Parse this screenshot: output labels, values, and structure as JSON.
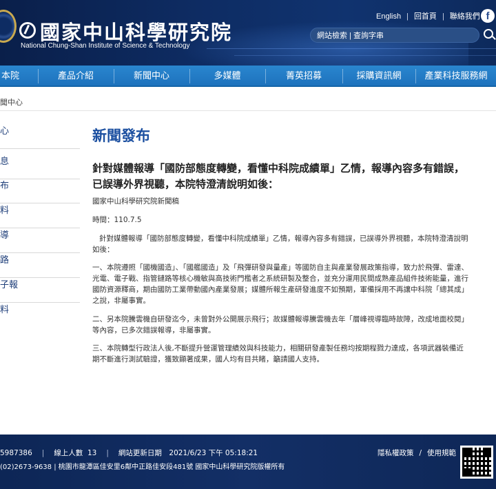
{
  "header": {
    "logo_title": "國家中山科學研究院",
    "logo_subtitle": "National Chung-Shan Institute of Science & Technology",
    "top_links": [
      "English",
      "回首頁",
      "聯絡我們"
    ],
    "facebook_label": "f",
    "search_placeholder": "網站檢索 | 查詢字串"
  },
  "nav": {
    "items": [
      "本院",
      "產品介紹",
      "新聞中心",
      "多媒體",
      "菁英招募",
      "採購資訊網",
      "產業科技服務網"
    ]
  },
  "breadcrumb": "聞中心",
  "sidebar": {
    "items": [
      "心",
      "息",
      "布",
      "料",
      "導",
      "路",
      "子報",
      "料"
    ]
  },
  "main": {
    "heading": "新聞發布",
    "title": "針對媒體報導「國防部態度轉變，看懂中科院成績單」乙情，報導內容多有錯誤，已誤導外界視聽，本院特澄清說明如後：",
    "press": "國家中山科學研究院新聞稿",
    "date": "時間：110.7.5",
    "paragraphs": [
      "針對媒體報導「國防部態度轉變，看懂中科院成績單」乙情，報導內容多有錯誤，已誤導外界視聽，本院特澄清說明如後：",
      "一、本院遵照「國機國造」、「國艦國造」及「飛彈研發與量產」等國防自主與產業發展政策指導，致力於飛彈、雷達、光電、電子戰、指管鏈路等核心機敏與高技術門檻者之系統研製及整合，並充分運用民間成熟產品組件技術能量，進行國防資源釋商，期由國防工業帶動國內產業發展；媒體所報生產研發進度不如預期，軍備採用不再讓中科院「總其成」之說，非屬事實。",
      "二、另本院騰雲機自研發迄今，未曾對外公開展示飛行；故媒體報導騰雲機去年「層峰視導臨時故障，改成地面校閱」等內容，已多次錯誤報導，非屬事實。",
      "三、本院轉型行政法人後,不斷提升營運管理績效與科技能力，相關研發產製任務均按期程戮力達成，各項武器裝備近期不斷進行測試驗證，獲致顯著成果，國人均有目共睹，籲請國人支持。"
    ]
  },
  "footer": {
    "visitors": "5987386",
    "online_label": "線上人數",
    "online_count": "13",
    "updated": "網站更新日期　2021/6/23 下午 05:18:21",
    "address": "(02)2673-9638 | 桃園市龍潭區佳安里6鄰中正路佳安段481號 國家中山科學研究院版權所有",
    "privacy": "隱私權政策",
    "policy": "使用規範"
  }
}
